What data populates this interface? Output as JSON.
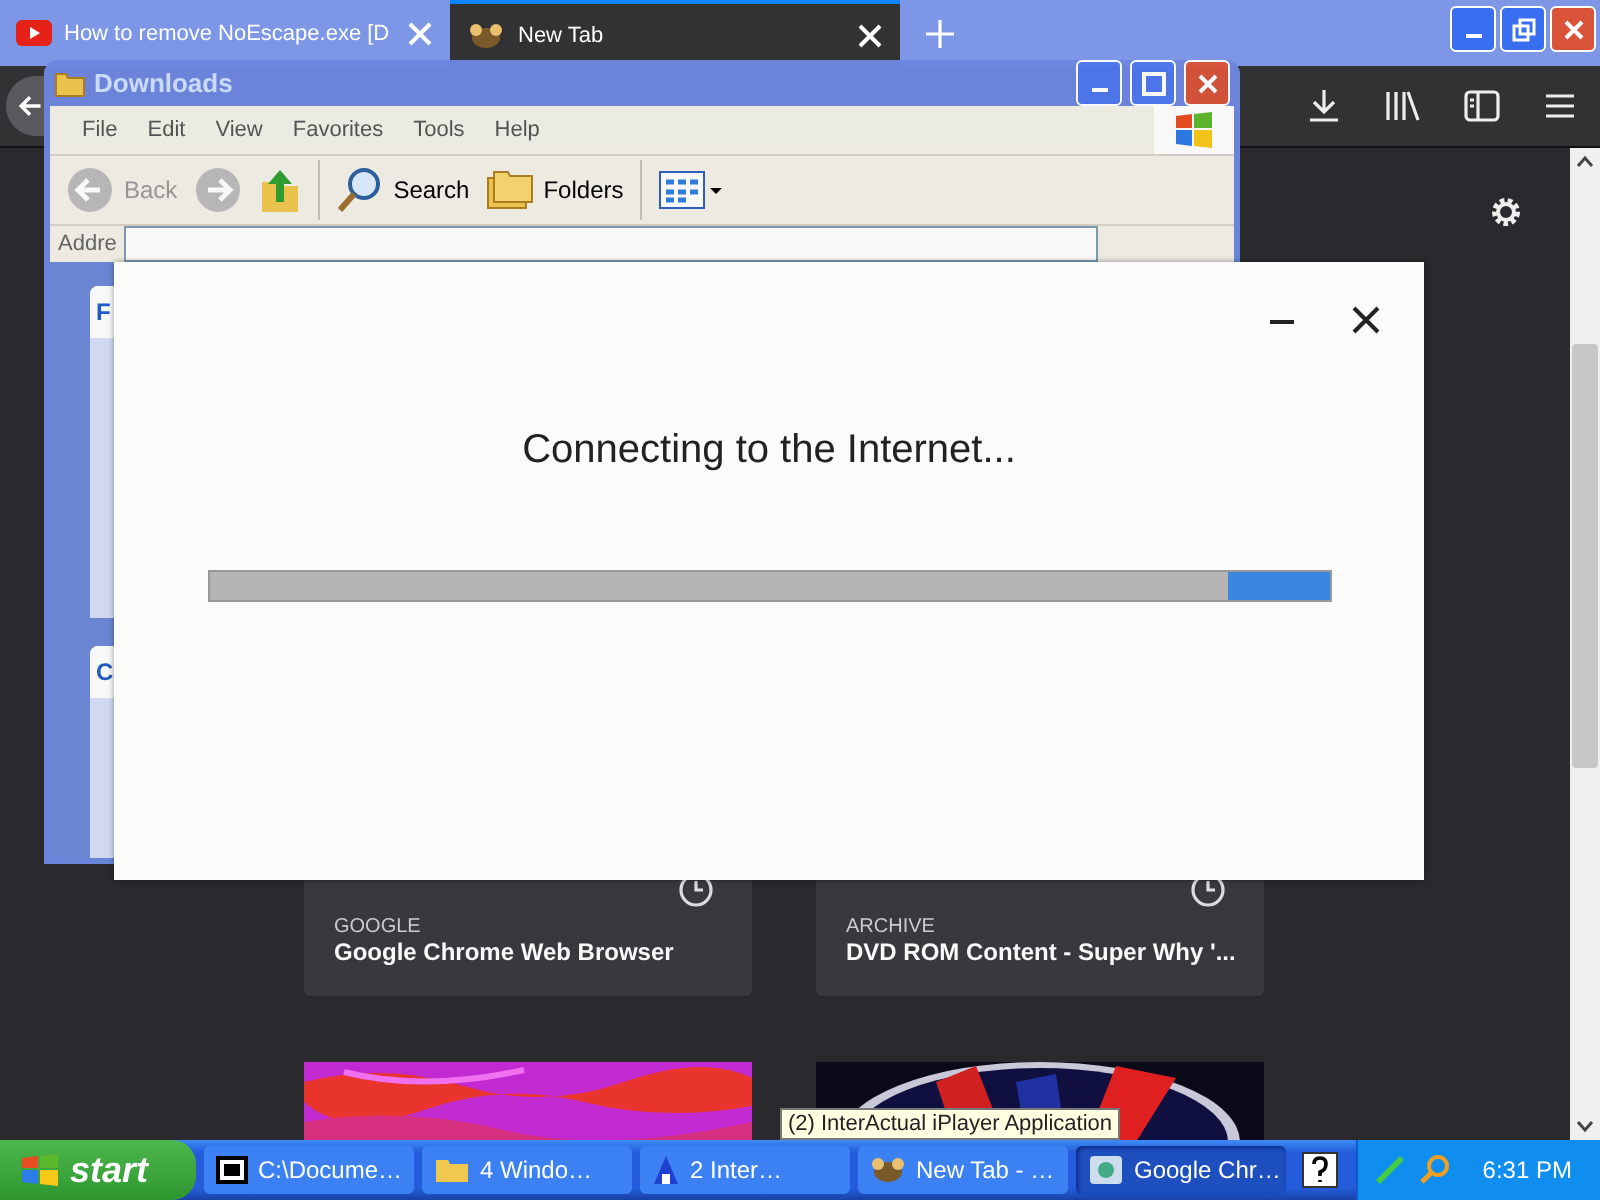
{
  "browser": {
    "tabs": [
      {
        "title": "How to remove NoEscape.exe [D",
        "selected": false
      },
      {
        "title": "New Tab",
        "selected": true
      }
    ],
    "cards": [
      {
        "source": "GOOGLE",
        "title": "Google Chrome Web Browser"
      },
      {
        "source": "ARCHIVE",
        "title": "DVD ROM Content - Super Why '..."
      }
    ]
  },
  "explorer": {
    "title": "Downloads",
    "menu": [
      "File",
      "Edit",
      "View",
      "Favorites",
      "Tools",
      "Help"
    ],
    "toolbar": {
      "back": "Back",
      "search": "Search",
      "folders": "Folders"
    },
    "address_label": "Addre",
    "panels": [
      "F",
      "C"
    ]
  },
  "dialog": {
    "message": "Connecting to the Internet...",
    "progress": {
      "level": 0.91
    }
  },
  "tooltip": "(2) InterActual iPlayer Application",
  "taskbar": {
    "start": "start",
    "buttons": [
      {
        "label": "C:\\Docume…",
        "selected": false
      },
      {
        "label": "4 Windo…",
        "selected": false
      },
      {
        "label": "2 Inter…",
        "selected": false
      },
      {
        "label": "New Tab - …",
        "selected": false
      },
      {
        "label": "Google Chr…",
        "selected": true
      }
    ],
    "clock": "6:31 PM"
  }
}
